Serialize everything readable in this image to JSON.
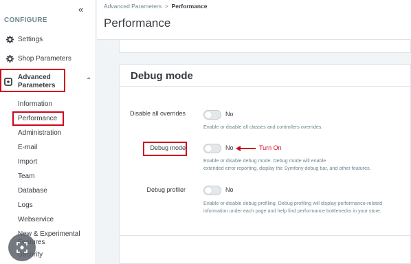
{
  "sidebar": {
    "collapse_icon": "chevrons-left",
    "section_title": "CONFIGURE",
    "items": [
      {
        "label": "Settings",
        "icon": "gear-icon"
      },
      {
        "label": "Shop Parameters",
        "icon": "gear-icon"
      }
    ],
    "advanced": {
      "label_line1": "Advanced",
      "label_line2": "Parameters",
      "icon": "advanced-icon",
      "chevron": "chevron-up"
    },
    "subitems": [
      "Information",
      "Performance",
      "Administration",
      "E-mail",
      "Import",
      "Team",
      "Database",
      "Logs",
      "Webservice",
      "New & Experimental Features",
      "Security"
    ]
  },
  "header": {
    "breadcrumb_parent": "Advanced Parameters",
    "breadcrumb_sep": ">",
    "breadcrumb_current": "Performance",
    "title": "Performance"
  },
  "debug_card": {
    "title": "Debug mode",
    "rows": [
      {
        "label": "Disable all overrides",
        "value": "No",
        "help_lines": [
          "Enable or disable all classes and controllers overrides."
        ]
      },
      {
        "label": "Debug mode",
        "value": "No",
        "help_lines": [
          "Enable or disable debug mode. Debug mode will enable",
          "extended error reporting, display the Symfony debug bar, and other features."
        ]
      },
      {
        "label": "Debug profiler",
        "value": "No",
        "help_lines": [
          "Enable or disable debug profiling. Debug profiling will display performance-related",
          "information under each page and help find performance bottlenecks in your store."
        ]
      }
    ],
    "annotation": "Turn On"
  },
  "colors": {
    "highlight": "#d0021b",
    "text": "#363a41",
    "muted": "#6c868e"
  }
}
